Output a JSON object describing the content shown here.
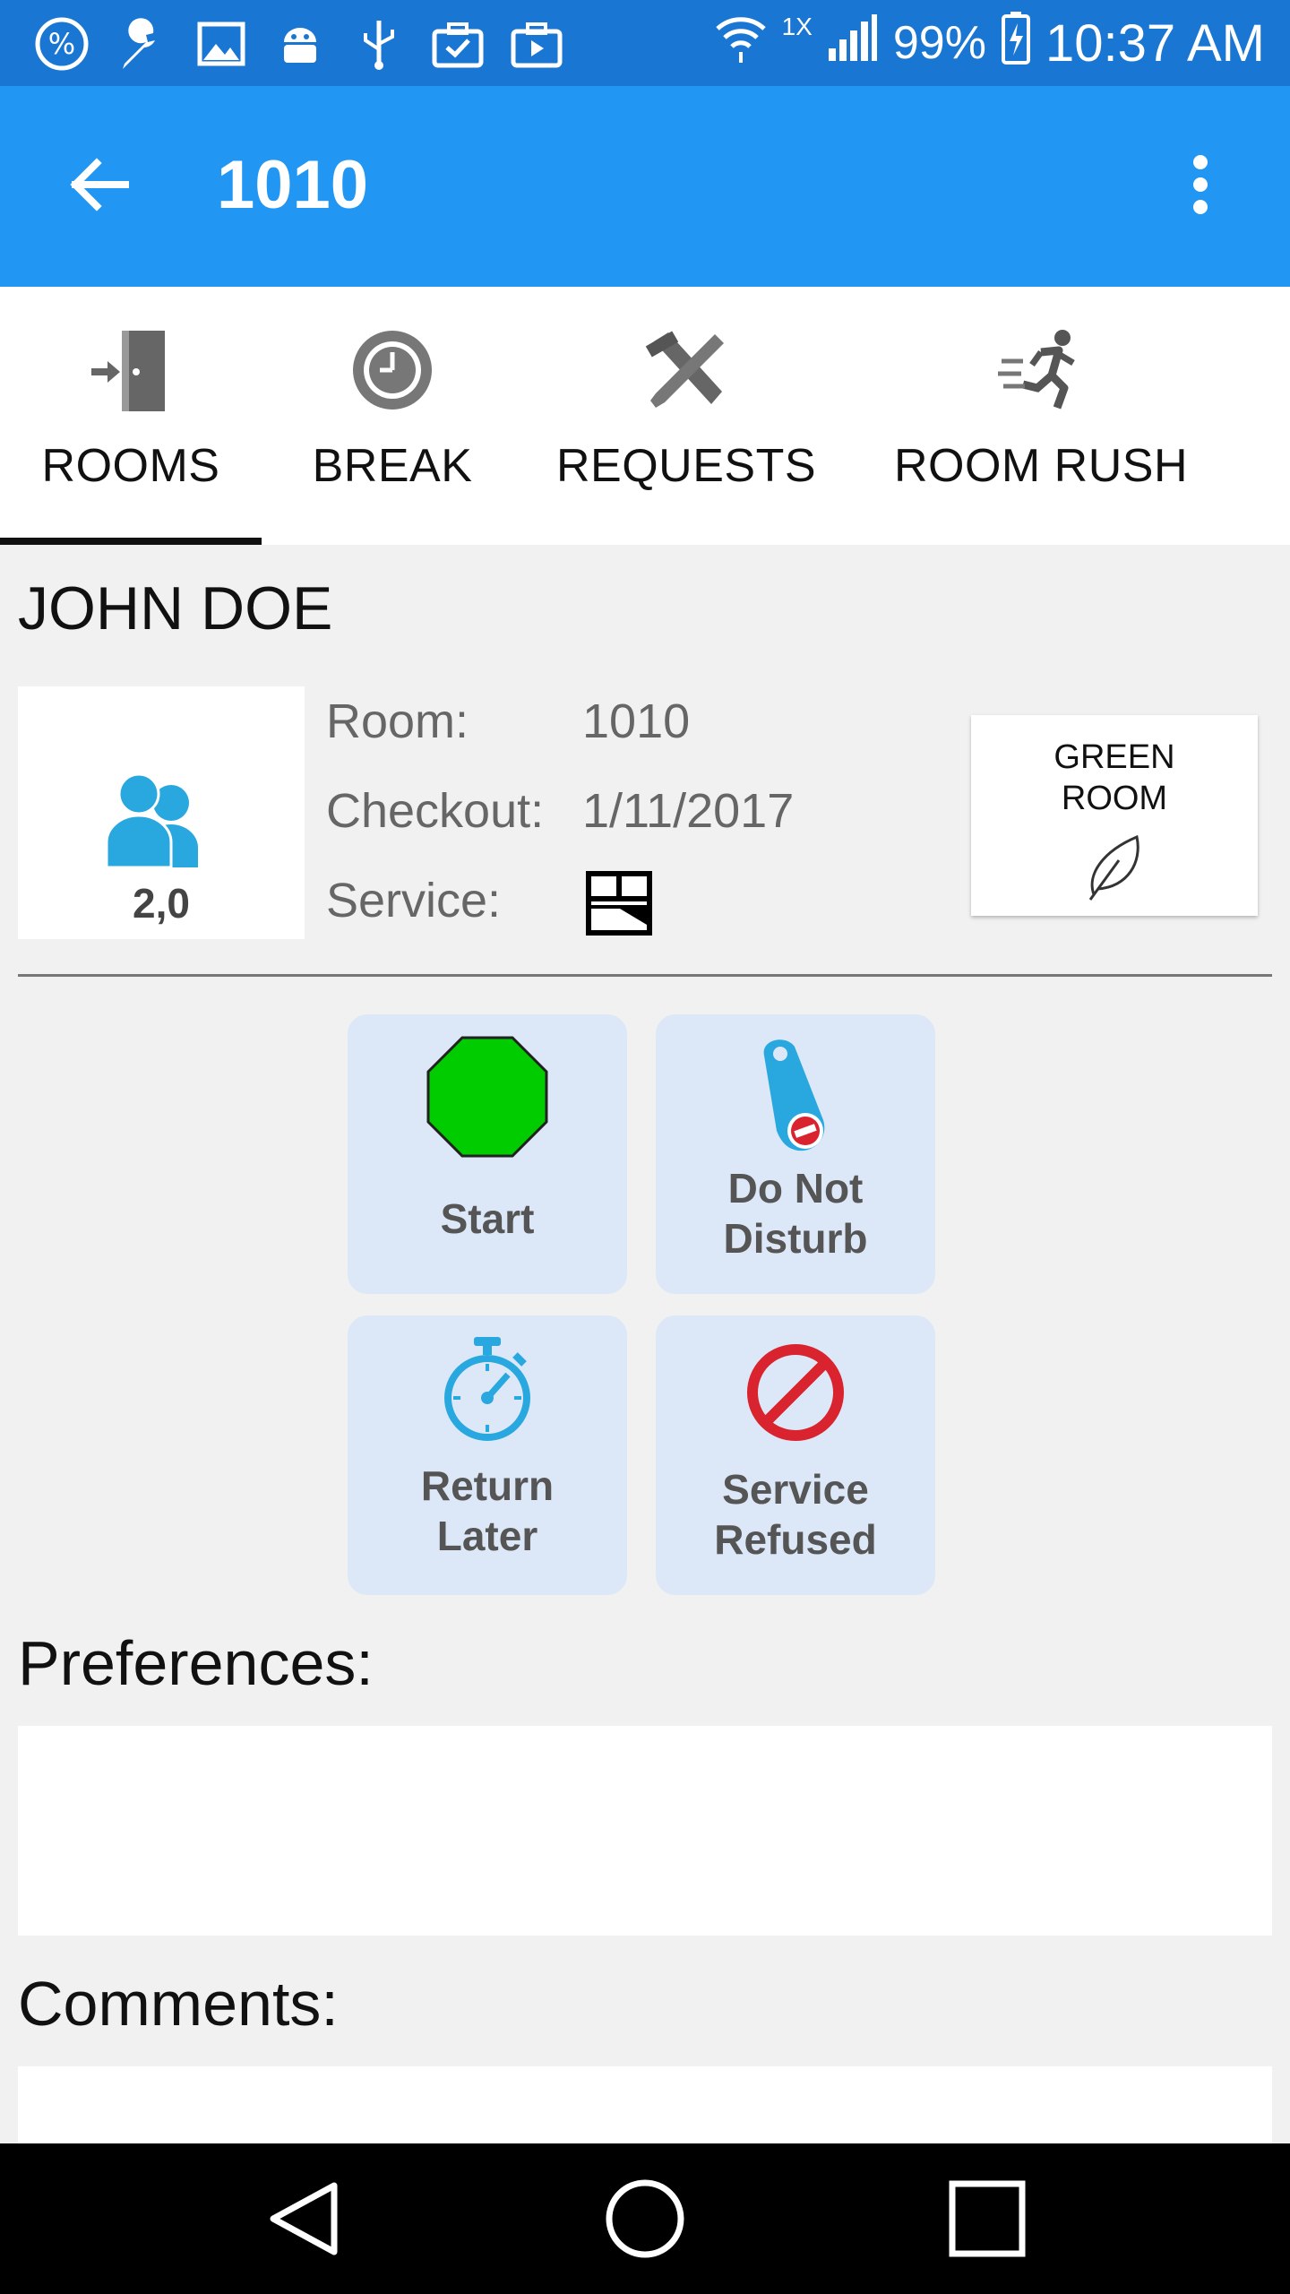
{
  "status_bar": {
    "icons": [
      "percent-icon",
      "wrench-icon",
      "image-icon",
      "android-icon",
      "usb-icon",
      "briefcase-check-icon",
      "briefcase-play-icon"
    ],
    "network": "1X",
    "battery": "99%",
    "time": "10:37 AM"
  },
  "app_bar": {
    "title": "1010"
  },
  "tabs": [
    {
      "label": "ROOMS",
      "icon": "door-enter-icon",
      "selected": true
    },
    {
      "label": "BREAK",
      "icon": "clock-icon",
      "selected": false
    },
    {
      "label": "REQUESTS",
      "icon": "tools-icon",
      "selected": false
    },
    {
      "label": "ROOM RUSH",
      "icon": "running-person-icon",
      "selected": false
    }
  ],
  "guest": {
    "name": "JOHN DOE",
    "occupancy": "2,0"
  },
  "room_info": {
    "room_label": "Room:",
    "room_value": "1010",
    "checkout_label": "Checkout:",
    "checkout_value": "1/11/2017",
    "service_label": "Service:"
  },
  "green_room": {
    "label": "GREEN\nROOM"
  },
  "actions": [
    {
      "label": "Start",
      "icon": "stop-sign-icon",
      "color": "#00cc00"
    },
    {
      "label": "Do Not\nDisturb",
      "icon": "door-hanger-icon",
      "color": "#29a8e0"
    },
    {
      "label": "Return\nLater",
      "icon": "stopwatch-icon",
      "color": "#29a8e0"
    },
    {
      "label": "Service\nRefused",
      "icon": "prohibited-icon",
      "color": "#d9232e"
    }
  ],
  "preferences_label": "Preferences:",
  "comments_label": "Comments:",
  "colors": {
    "status_bar": "#1976d2",
    "app_bar": "#2196f3",
    "action_bg": "#dce8f7"
  }
}
